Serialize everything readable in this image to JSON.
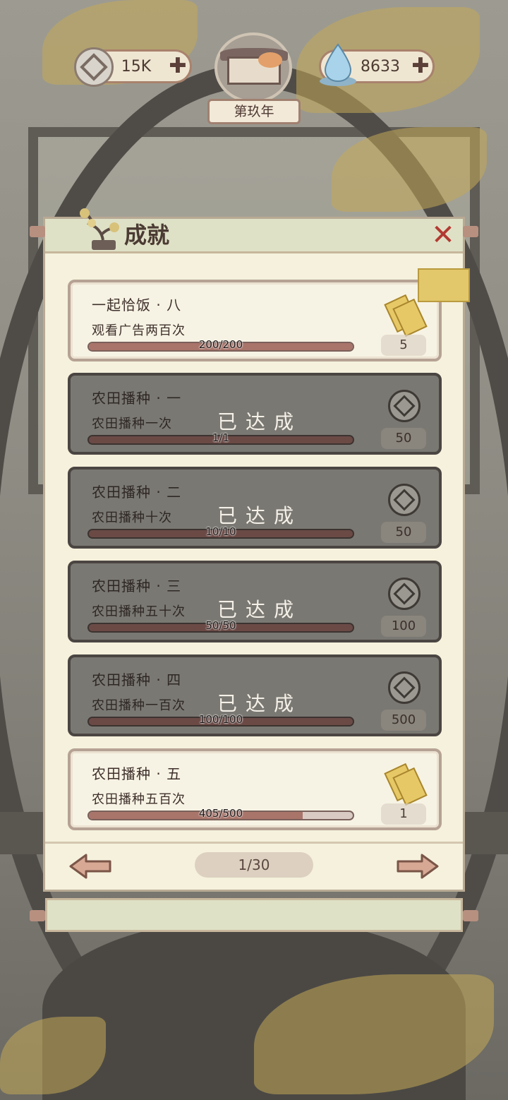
{
  "top": {
    "coins": "15K",
    "spirit": "8633",
    "plus_symbol": "✚",
    "year_label": "第玖年"
  },
  "panel": {
    "title": "成就",
    "close_symbol": "✕"
  },
  "achievement_label": "已达成",
  "achievements": [
    {
      "name": "一起恰饭 · 八",
      "desc": "观看广告两百次",
      "progress": "200/200",
      "progress_ratio": 1.0,
      "reward": "5",
      "reward_icon": "ticket-icon",
      "status": "active"
    },
    {
      "name": "农田播种 · 一",
      "desc": "农田播种一次",
      "progress": "1/1",
      "progress_ratio": 1.0,
      "reward": "50",
      "reward_icon": "coin-icon",
      "status": "done"
    },
    {
      "name": "农田播种 · 二",
      "desc": "农田播种十次",
      "progress": "10/10",
      "progress_ratio": 1.0,
      "reward": "50",
      "reward_icon": "coin-icon",
      "status": "done"
    },
    {
      "name": "农田播种 · 三",
      "desc": "农田播种五十次",
      "progress": "50/50",
      "progress_ratio": 1.0,
      "reward": "100",
      "reward_icon": "coin-icon",
      "status": "done"
    },
    {
      "name": "农田播种 · 四",
      "desc": "农田播种一百次",
      "progress": "100/100",
      "progress_ratio": 1.0,
      "reward": "500",
      "reward_icon": "coin-icon",
      "status": "done"
    },
    {
      "name": "农田播种 · 五",
      "desc": "农田播种五百次",
      "progress": "405/500",
      "progress_ratio": 0.81,
      "reward": "1",
      "reward_icon": "ticket-icon",
      "status": "active"
    }
  ],
  "pager": {
    "page": "1/30"
  },
  "colors": {
    "accent_red": "#b23a32",
    "progress_fill": "#a9746a",
    "panel_bg": "#f5f1dc"
  }
}
